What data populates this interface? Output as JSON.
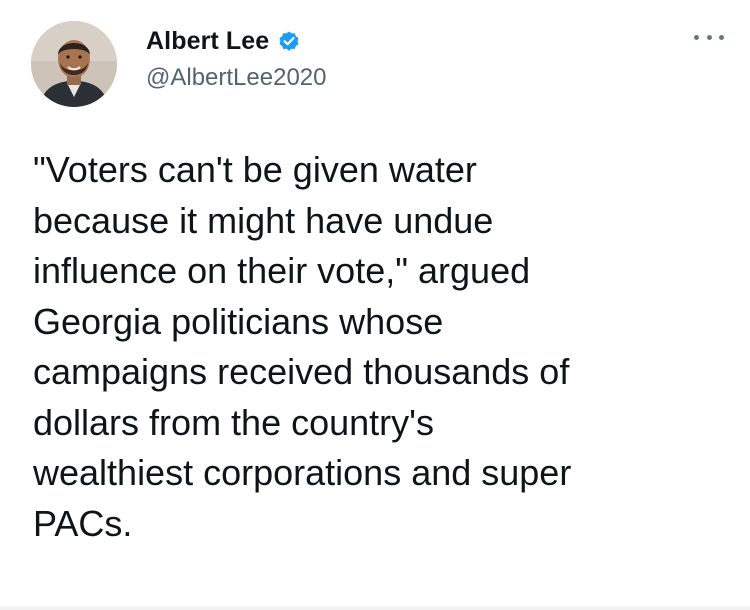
{
  "tweet": {
    "author": {
      "display_name": "Albert Lee",
      "handle": "@AlbertLee2020",
      "verified": true,
      "avatar_icon": "user-avatar-photo"
    },
    "text": "\"Voters can't be given water\nbecause it might have undue\ninfluence on their vote,\" argued\nGeorgia politicians whose\ncampaigns received thousands of\ndollars from the country's\nwealthiest corporations and super\nPACs.",
    "more_icon": "more-options-icon"
  },
  "colors": {
    "verified_badge": "#1d9bf0",
    "text_primary": "#0f1419",
    "text_secondary": "#536471"
  }
}
